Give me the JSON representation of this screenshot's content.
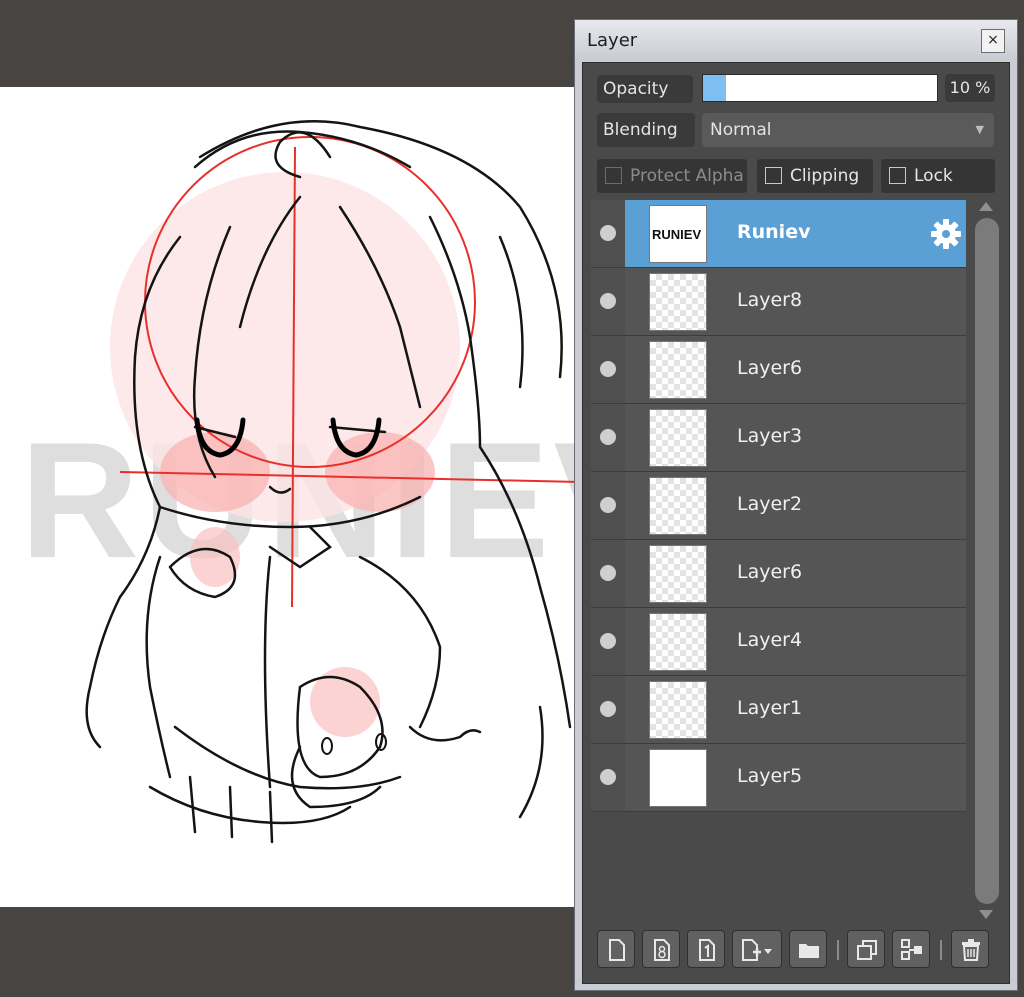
{
  "panel": {
    "title": "Layer",
    "close_label": "×",
    "opacity": {
      "label": "Opacity",
      "percent": 10,
      "value_text": "10 %"
    },
    "blending": {
      "label": "Blending",
      "value": "Normal"
    },
    "checks": [
      {
        "label": "Protect Alpha",
        "checked": false,
        "disabled": true
      },
      {
        "label": "Clipping",
        "checked": false,
        "disabled": false
      },
      {
        "label": "Lock",
        "checked": false,
        "disabled": false
      }
    ],
    "layers": [
      {
        "name": "Runiev",
        "selected": true,
        "thumb_text": "RUNIEV"
      },
      {
        "name": "Layer8",
        "selected": false
      },
      {
        "name": "Layer6",
        "selected": false
      },
      {
        "name": "Layer3",
        "selected": false
      },
      {
        "name": "Layer2",
        "selected": false
      },
      {
        "name": "Layer6",
        "selected": false
      },
      {
        "name": "Layer4",
        "selected": false
      },
      {
        "name": "Layer1",
        "selected": false
      },
      {
        "name": "Layer5",
        "selected": false
      }
    ],
    "toolbar": [
      "new-layer-icon",
      "new-8bit-layer-icon",
      "new-1bit-layer-icon",
      "add-layer-dropdown-icon",
      "new-folder-icon",
      "duplicate-layer-icon",
      "merge-down-icon",
      "delete-layer-icon"
    ]
  },
  "canvas": {
    "watermark": "RUNIEV"
  },
  "colors": {
    "accent": "#5aa0d5",
    "panel_bg": "#4a4a4a",
    "sketch_red": "#e8302a"
  }
}
